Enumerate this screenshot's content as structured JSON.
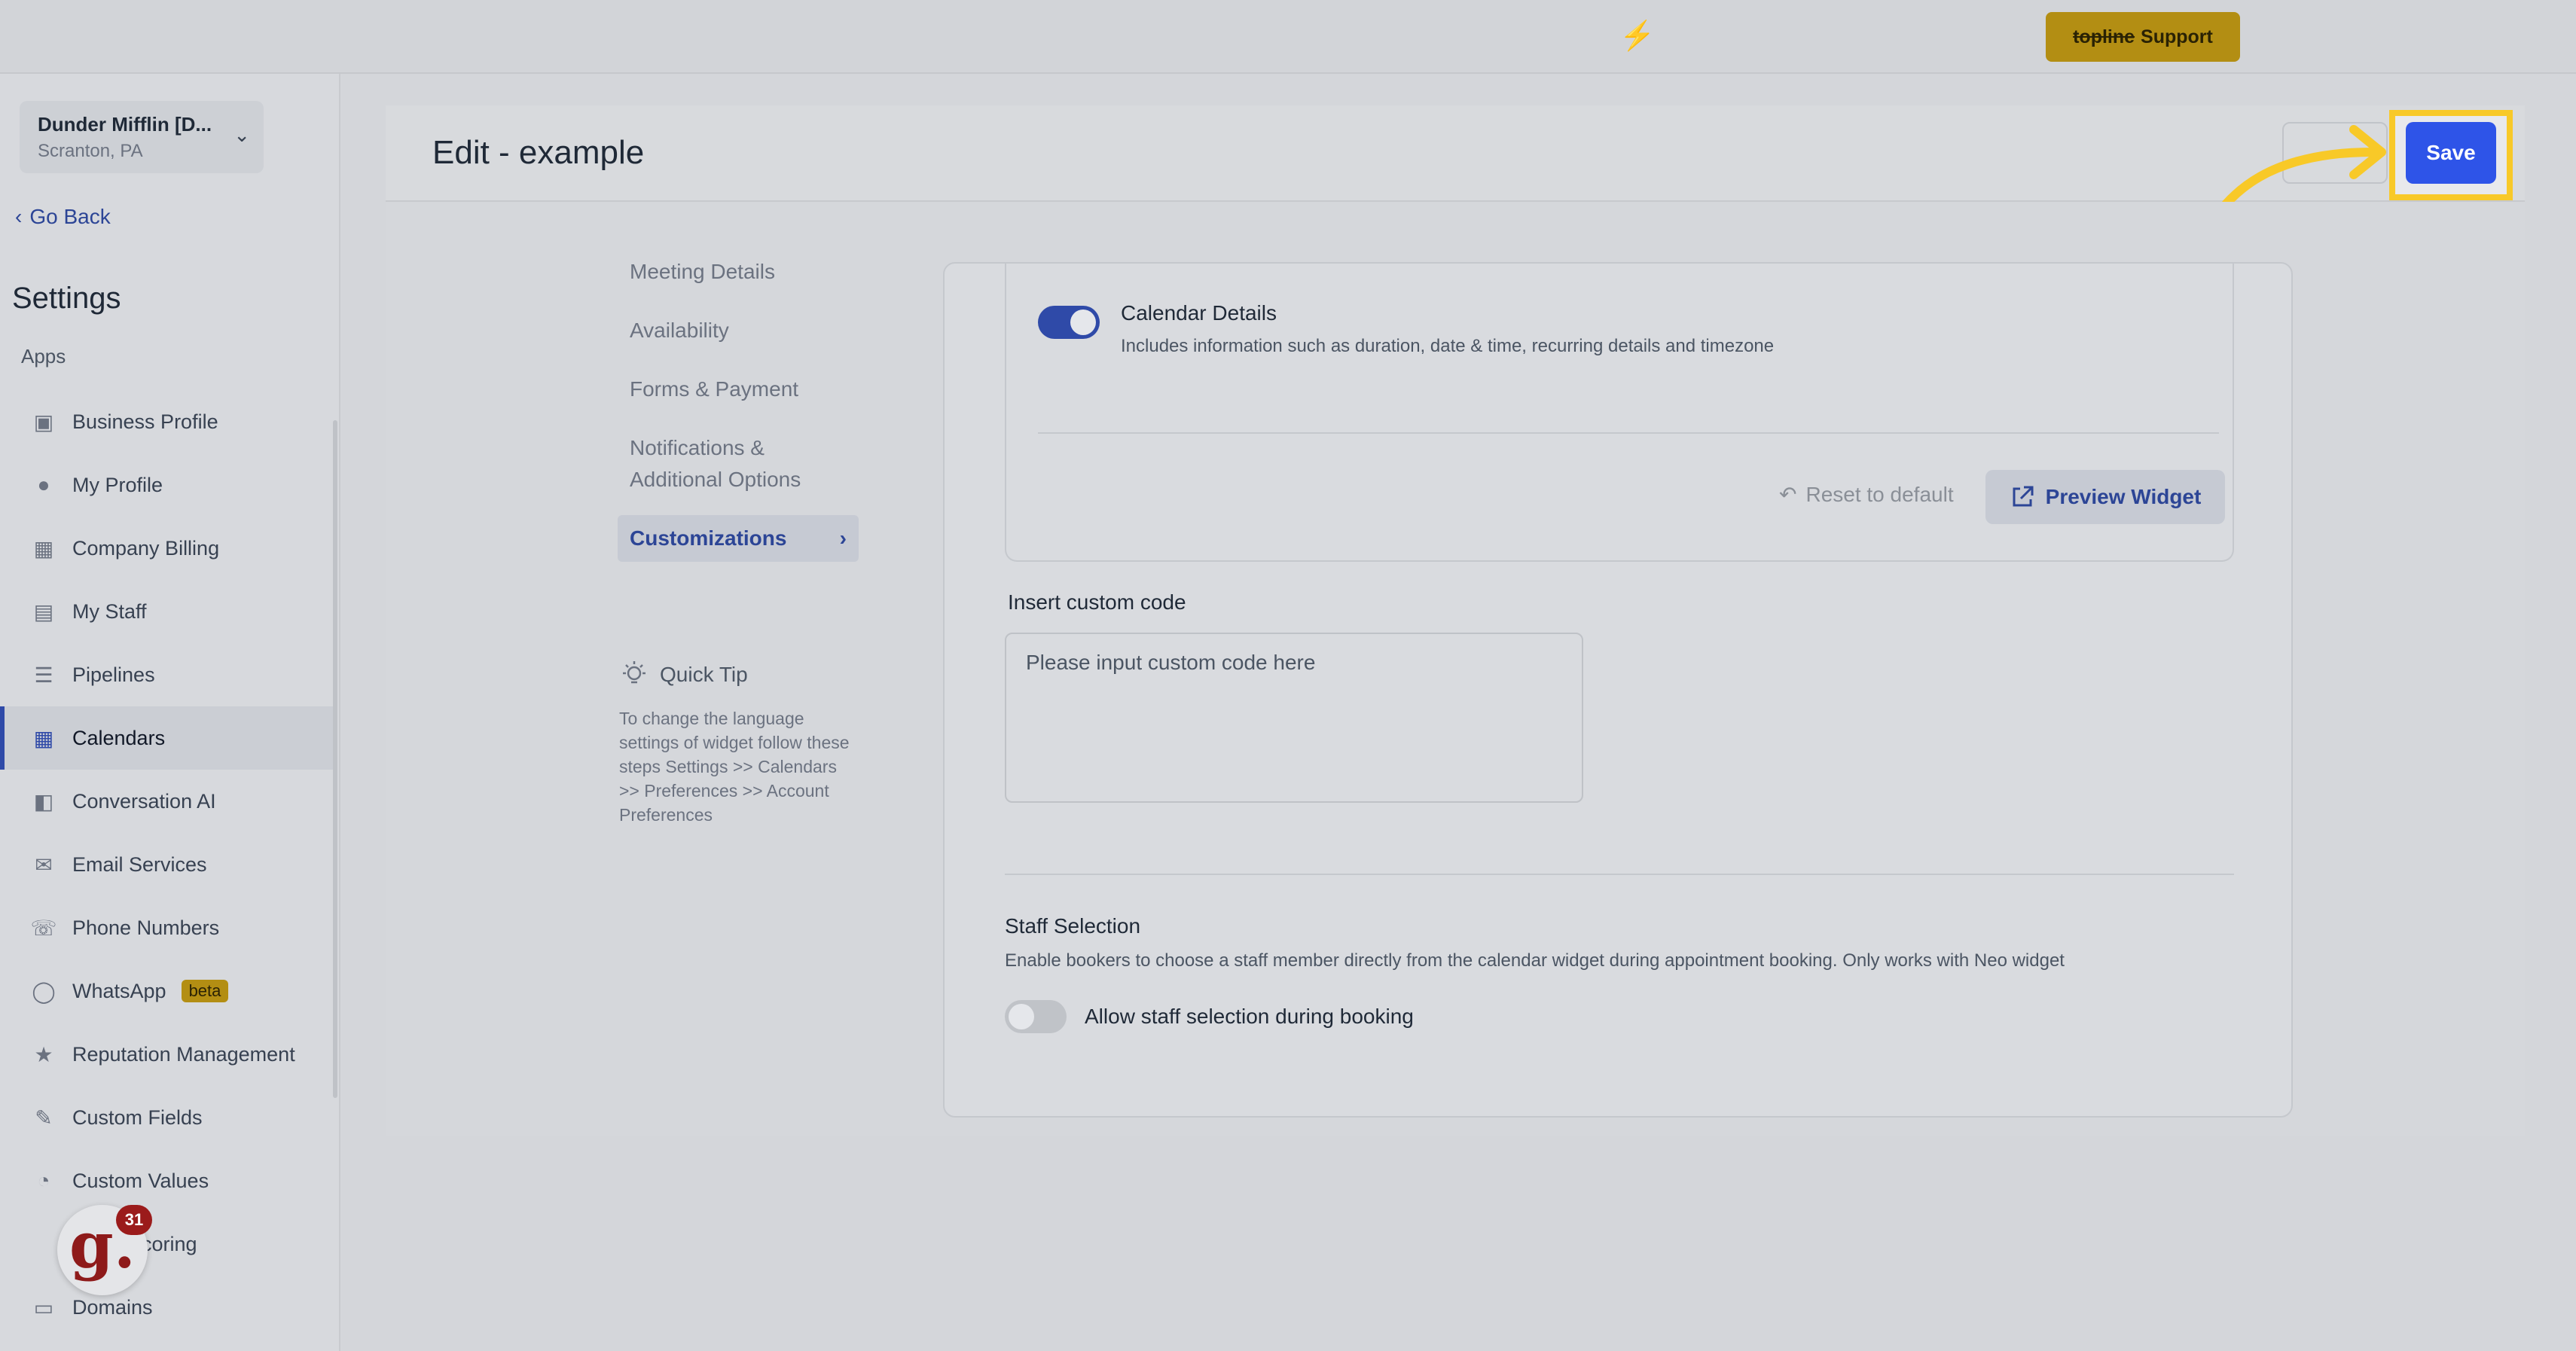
{
  "topbar": {
    "support_brand": "topline",
    "support_label": "Support"
  },
  "sidebar": {
    "location_name": "Dunder Mifflin [D...",
    "location_sub": "Scranton, PA",
    "go_back": "Go Back",
    "settings_title": "Settings",
    "apps_label": "Apps",
    "items": [
      {
        "label": "Business Profile",
        "icon": "briefcase-icon"
      },
      {
        "label": "My Profile",
        "icon": "user-icon"
      },
      {
        "label": "Company Billing",
        "icon": "grid-icon"
      },
      {
        "label": "My Staff",
        "icon": "staff-icon"
      },
      {
        "label": "Pipelines",
        "icon": "pipeline-icon"
      },
      {
        "label": "Calendars",
        "icon": "calendar-icon",
        "active": true
      },
      {
        "label": "Conversation AI",
        "icon": "chat-icon"
      },
      {
        "label": "Email Services",
        "icon": "mail-icon"
      },
      {
        "label": "Phone Numbers",
        "icon": "phone-icon"
      },
      {
        "label": "WhatsApp",
        "icon": "whatsapp-icon",
        "badge": "beta"
      },
      {
        "label": "Reputation Management",
        "icon": "star-icon"
      },
      {
        "label": "Custom Fields",
        "icon": "edit-icon"
      },
      {
        "label": "Custom Values",
        "icon": "pie-icon"
      },
      {
        "label": "Scoring",
        "icon": "chart-icon"
      },
      {
        "label": "Domains",
        "icon": "domain-icon"
      }
    ],
    "notification_count": "31"
  },
  "header": {
    "title": "Edit - example",
    "save_label": "Save"
  },
  "steps": {
    "items": [
      "Meeting Details",
      "Availability",
      "Forms & Payment",
      "Notifications & Additional Options"
    ],
    "active": "Customizations"
  },
  "tip": {
    "title": "Quick Tip",
    "body": "To change the language settings of widget follow these steps Settings >> Calendars >> Preferences >> Account Preferences"
  },
  "customizations": {
    "calendar_details_title": "Calendar Details",
    "calendar_details_desc": "Includes information such as duration, date & time, recurring details and timezone",
    "reset_label": "Reset to default",
    "preview_label": "Preview Widget",
    "custom_code_label": "Insert custom code",
    "custom_code_placeholder": "Please input custom code here",
    "staff_title": "Staff Selection",
    "staff_desc": "Enable bookers to choose a staff member directly from the calendar widget during appointment booking. Only works with Neo widget",
    "staff_toggle_label": "Allow staff selection during booking"
  },
  "colors": {
    "accent": "#2e54e8",
    "highlight": "#f8c928",
    "active_nav": "#2f4aa8"
  }
}
